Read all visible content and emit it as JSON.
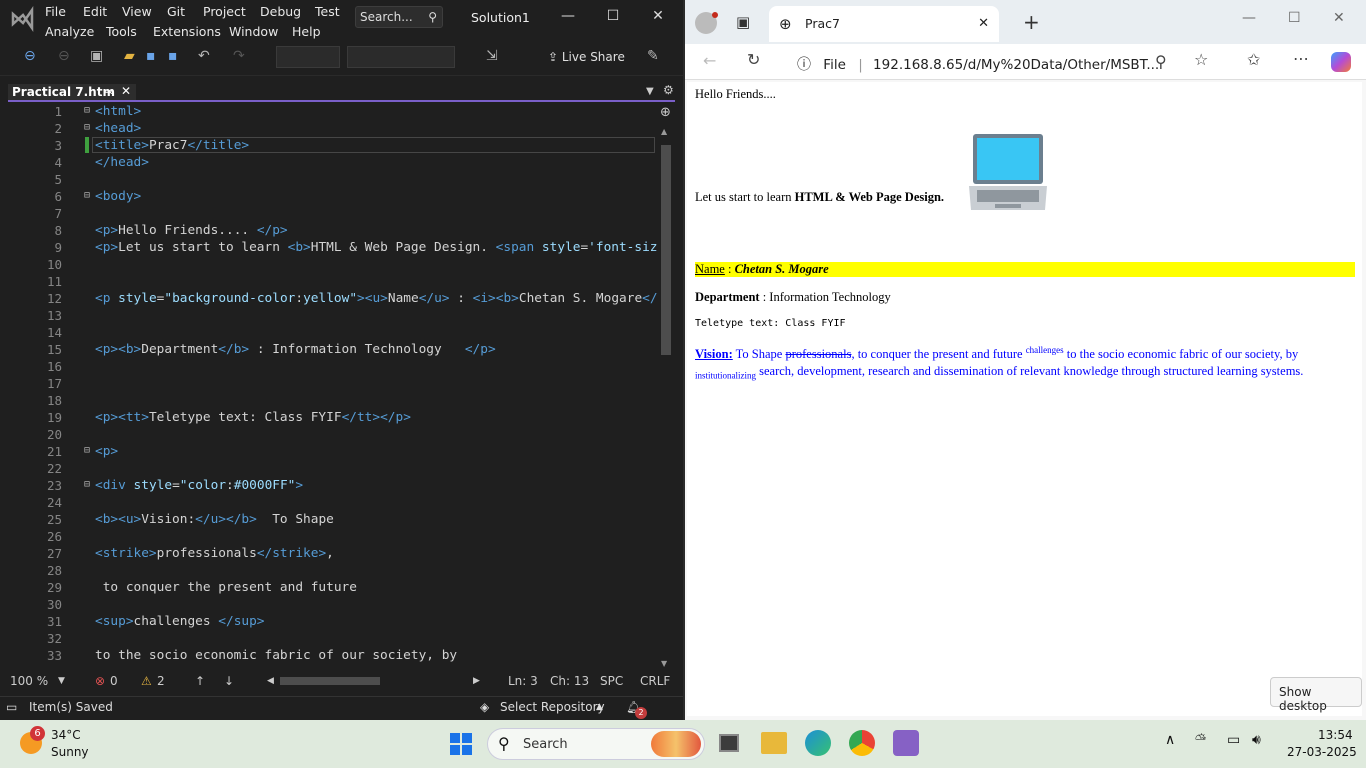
{
  "vs": {
    "menu": [
      "File",
      "Edit",
      "View",
      "Git",
      "Project",
      "Debug",
      "Test",
      "Analyze",
      "Tools",
      "Extensions",
      "Window",
      "Help"
    ],
    "search": "Search...",
    "solution": "Solution1",
    "live_share": "Live Share",
    "tab_title": "Practical 7.htm",
    "lines": [
      {
        "n": "1",
        "fold": "⊟",
        "html": "<span class='tag'>&lt;html&gt;</span>"
      },
      {
        "n": "2",
        "fold": "⊟",
        "html": "<span class='tag'>&lt;head&gt;</span>"
      },
      {
        "n": "3",
        "fold": "",
        "html": "<span class='tag'>&lt;title&gt;</span>Prac7<span class='tag'>&lt;/title&gt;</span>"
      },
      {
        "n": "4",
        "fold": "",
        "html": "<span class='tag'>&lt;/head&gt;</span>"
      },
      {
        "n": "5",
        "fold": "",
        "html": ""
      },
      {
        "n": "6",
        "fold": "⊟",
        "html": "<span class='tag'>&lt;body&gt;</span>"
      },
      {
        "n": "7",
        "fold": "",
        "html": ""
      },
      {
        "n": "8",
        "fold": "",
        "html": "<span class='tag'>&lt;p&gt;</span>Hello Friends.... <span class='tag'>&lt;/p&gt;</span>"
      },
      {
        "n": "9",
        "fold": "",
        "html": "<span class='tag'>&lt;p&gt;</span>Let us start to learn <span class='tag'>&lt;b&gt;</span>HTML &amp; Web Page Design. <span class='tag'>&lt;span</span> <span class='att'>style</span>=<span class='att'>'font-siz</span>"
      },
      {
        "n": "10",
        "fold": "",
        "html": ""
      },
      {
        "n": "11",
        "fold": "",
        "html": ""
      },
      {
        "n": "12",
        "fold": "",
        "html": "<span class='tag'>&lt;p</span> <span class='att'>style</span>=<span class='att'>\"background-color</span>:<span class='att'>yellow\"</span><span class='tag'>&gt;&lt;u&gt;</span>Name<span class='tag'>&lt;/u&gt;</span> : <span class='tag'>&lt;i&gt;&lt;b&gt;</span>Chetan S. Mogare<span class='tag'>&lt;/</span>"
      },
      {
        "n": "13",
        "fold": "",
        "html": ""
      },
      {
        "n": "14",
        "fold": "",
        "html": ""
      },
      {
        "n": "15",
        "fold": "",
        "html": "<span class='tag'>&lt;p&gt;&lt;b&gt;</span>Department<span class='tag'>&lt;/b&gt;</span> : Information Technology   <span class='tag'>&lt;/p&gt;</span>"
      },
      {
        "n": "16",
        "fold": "",
        "html": ""
      },
      {
        "n": "17",
        "fold": "",
        "html": ""
      },
      {
        "n": "18",
        "fold": "",
        "html": ""
      },
      {
        "n": "19",
        "fold": "",
        "html": "<span class='tag'>&lt;p&gt;&lt;tt&gt;</span>Teletype text: Class FYIF<span class='tag'>&lt;/tt&gt;&lt;/p&gt;</span>"
      },
      {
        "n": "20",
        "fold": "",
        "html": ""
      },
      {
        "n": "21",
        "fold": "⊟",
        "html": "<span class='tag'>&lt;p&gt;</span>"
      },
      {
        "n": "22",
        "fold": "",
        "html": ""
      },
      {
        "n": "23",
        "fold": "⊟",
        "html": "<span class='tag'>&lt;div</span> <span class='att'>style</span>=<span class='att'>\"color</span>:<span class='att'>#0000FF\"</span><span class='tag'>&gt;</span>"
      },
      {
        "n": "24",
        "fold": "",
        "html": ""
      },
      {
        "n": "25",
        "fold": "",
        "html": "<span class='tag'>&lt;b&gt;&lt;u&gt;</span>Vision:<span class='tag'>&lt;/u&gt;&lt;/b&gt;</span>  To Shape"
      },
      {
        "n": "26",
        "fold": "",
        "html": ""
      },
      {
        "n": "27",
        "fold": "",
        "html": "<span class='tag'>&lt;strike&gt;</span>professionals<span class='tag'>&lt;/strike&gt;</span>,"
      },
      {
        "n": "28",
        "fold": "",
        "html": ""
      },
      {
        "n": "29",
        "fold": "",
        "html": " to conquer the present and future"
      },
      {
        "n": "30",
        "fold": "",
        "html": ""
      },
      {
        "n": "31",
        "fold": "",
        "html": "<span class='tag'>&lt;sup&gt;</span>challenges <span class='tag'>&lt;/sup&gt;</span>"
      },
      {
        "n": "32",
        "fold": "",
        "html": ""
      },
      {
        "n": "33",
        "fold": "",
        "html": "to the socio economic fabric of our society, by"
      }
    ],
    "zoom": "100 %",
    "errors": "0",
    "warnings": "2",
    "ln": "Ln: 3",
    "ch": "Ch: 13",
    "spc": "SPC",
    "crlf": "CRLF",
    "saved": "Item(s) Saved",
    "repo": "Select Repository",
    "notif": "2"
  },
  "browser": {
    "tab": "Prac7",
    "file": "File",
    "url": "192.168.8.65/d/My%20Data/Other/MSBT...",
    "hello": "Hello Friends....",
    "learn": "Let us start to learn ",
    "learn_b": "HTML & Web Page Design.",
    "name_label": "Name",
    "name_val": "Chetan S. Mogare",
    "dept_label": "Department",
    "dept_val": " : Information Technology",
    "tt": "Teletype text: Class FYIF",
    "vision_label": "Vision:",
    "v1": " To Shape ",
    "v_strike": "professionals",
    "v2": ", to conquer the present and future ",
    "v_sup": "challenges",
    "v3": " to the socio economic fabric of our society, by",
    "v_sub": "institutionalizing",
    "v4": " search, development, research and dissemination of relevant knowledge through structured learning systems.",
    "show_desktop": "Show desktop"
  },
  "taskbar": {
    "temp": "34°C",
    "weather": "Sunny",
    "weather_badge": "6",
    "search": "Search",
    "time": "13:54",
    "date": "27-03-2025"
  }
}
